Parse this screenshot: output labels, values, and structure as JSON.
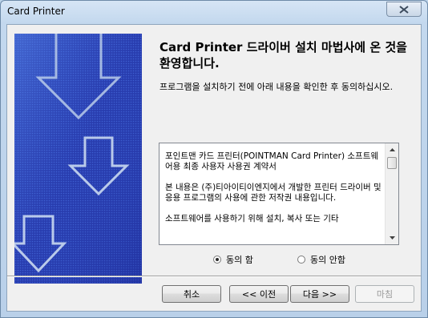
{
  "window": {
    "title": "Card Printer"
  },
  "heading": "Card Printer 드라이버 설치 마법사에 온 것을 환영합니다.",
  "intro": "프로그램을 설치하기 전에 아래 내용을 확인한 후 동의하십시오.",
  "license": {
    "paragraphs": [
      "포인트맨 카드 프린터(POINTMAN Card Printer) 소프트웨어용 최종 사용자 사용권 계약서",
      "본 내용은 (주)티아이티이엔지에서 개발한 프린터 드라이버 및 응용 프로그램의 사용에 관한 저작권 내용입니다.",
      "소프트웨어를 사용하기 위해 설치, 복사 또는 기타"
    ]
  },
  "agreement": {
    "agree_label": "동의 함",
    "disagree_label": "동의 안함",
    "selected": "agree"
  },
  "buttons": {
    "cancel": "취소",
    "back": "<< 이전",
    "next": "다음 >>",
    "finish": "마침"
  },
  "colors": {
    "banner_blue": "#2a3fb0",
    "accent": "#000000"
  }
}
